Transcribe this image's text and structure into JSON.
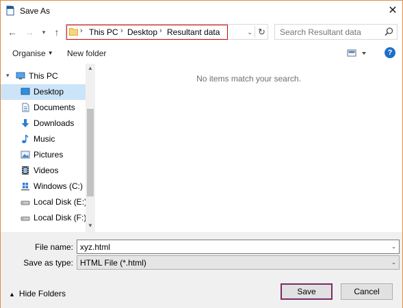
{
  "window": {
    "title": "Save As",
    "close_glyph": "✕"
  },
  "nav": {
    "back_glyph": "←",
    "forward_glyph": "→",
    "recent_glyph": "▾",
    "up_glyph": "↑",
    "breadcrumbs": [
      "This PC",
      "Desktop",
      "Resultant data"
    ],
    "separator": "›",
    "dropdown_glyph": "⌄",
    "refresh_glyph": "↻"
  },
  "search": {
    "placeholder": "Search Resultant data"
  },
  "toolbar": {
    "organise_label": "Organise",
    "new_folder_label": "New folder",
    "help_glyph": "?"
  },
  "tree": {
    "items": [
      {
        "label": "This PC",
        "icon": "monitor-icon",
        "selected": false
      },
      {
        "label": "Desktop",
        "icon": "desktop-icon",
        "selected": true
      },
      {
        "label": "Documents",
        "icon": "documents-icon",
        "selected": false
      },
      {
        "label": "Downloads",
        "icon": "download-arrow-icon",
        "selected": false
      },
      {
        "label": "Music",
        "icon": "music-note-icon",
        "selected": false
      },
      {
        "label": "Pictures",
        "icon": "pictures-icon",
        "selected": false
      },
      {
        "label": "Videos",
        "icon": "film-icon",
        "selected": false
      },
      {
        "label": "Windows (C:)",
        "icon": "windows-drive-icon",
        "selected": false
      },
      {
        "label": "Local Disk (E:)",
        "icon": "disk-drive-icon",
        "selected": false
      },
      {
        "label": "Local Disk (F:)",
        "icon": "disk-drive-icon",
        "selected": false
      }
    ]
  },
  "content": {
    "empty_message": "No items match your search."
  },
  "form": {
    "file_name_label": "File name:",
    "file_name_value": "xyz.html",
    "save_type_label": "Save as type:",
    "save_type_value": "HTML File (*.html)"
  },
  "footer": {
    "hide_folders_label": "Hide Folders",
    "save_label": "Save",
    "cancel_label": "Cancel"
  },
  "colors": {
    "accent": "#1c6fc9",
    "selection": "#cce4f7",
    "highlight_border": "#cc0000",
    "frame": "#e38a3c"
  }
}
